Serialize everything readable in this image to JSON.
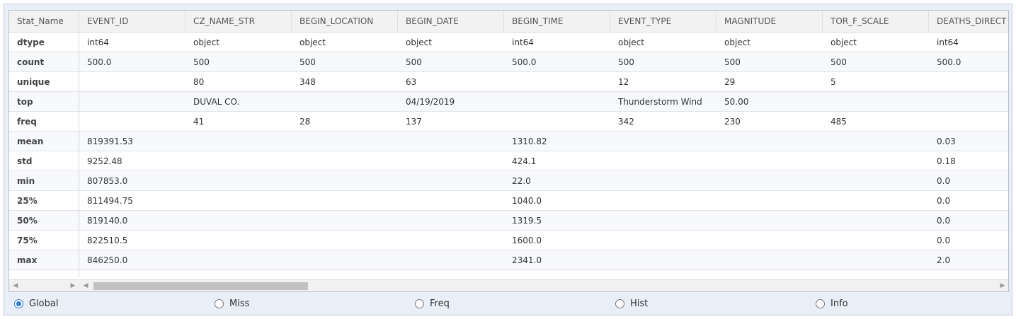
{
  "table": {
    "index_header": "Stat_Name",
    "columns": [
      "EVENT_ID",
      "CZ_NAME_STR",
      "BEGIN_LOCATION",
      "BEGIN_DATE",
      "BEGIN_TIME",
      "EVENT_TYPE",
      "MAGNITUDE",
      "TOR_F_SCALE",
      "DEATHS_DIRECT"
    ],
    "rows": [
      {
        "stat": "dtype",
        "cells": [
          "int64",
          "object",
          "object",
          "object",
          "int64",
          "object",
          "object",
          "object",
          "int64"
        ]
      },
      {
        "stat": "count",
        "cells": [
          "500.0",
          "500",
          "500",
          "500",
          "500.0",
          "500",
          "500",
          "500",
          "500.0"
        ]
      },
      {
        "stat": "unique",
        "cells": [
          "",
          "80",
          "348",
          "63",
          "",
          "12",
          "29",
          "5",
          ""
        ]
      },
      {
        "stat": "top",
        "cells": [
          "",
          "DUVAL CO.",
          "",
          "04/19/2019",
          "",
          "Thunderstorm Wind",
          "50.00",
          "",
          ""
        ]
      },
      {
        "stat": "freq",
        "cells": [
          "",
          "41",
          "28",
          "137",
          "",
          "342",
          "230",
          "485",
          ""
        ]
      },
      {
        "stat": "mean",
        "cells": [
          "819391.53",
          "",
          "",
          "",
          "1310.82",
          "",
          "",
          "",
          "0.03"
        ]
      },
      {
        "stat": "std",
        "cells": [
          "9252.48",
          "",
          "",
          "",
          "424.1",
          "",
          "",
          "",
          "0.18"
        ]
      },
      {
        "stat": "min",
        "cells": [
          "807853.0",
          "",
          "",
          "",
          "22.0",
          "",
          "",
          "",
          "0.0"
        ]
      },
      {
        "stat": "25%",
        "cells": [
          "811494.75",
          "",
          "",
          "",
          "1040.0",
          "",
          "",
          "",
          "0.0"
        ]
      },
      {
        "stat": "50%",
        "cells": [
          "819140.0",
          "",
          "",
          "",
          "1319.5",
          "",
          "",
          "",
          "0.0"
        ]
      },
      {
        "stat": "75%",
        "cells": [
          "822510.5",
          "",
          "",
          "",
          "1600.0",
          "",
          "",
          "",
          "0.0"
        ]
      },
      {
        "stat": "max",
        "cells": [
          "846250.0",
          "",
          "",
          "",
          "2341.0",
          "",
          "",
          "",
          "2.0"
        ]
      }
    ]
  },
  "scrollbar": {
    "left_arrow": "◀",
    "right_arrow": "▶"
  },
  "radio_options": [
    {
      "label": "Global",
      "checked": true
    },
    {
      "label": "Miss",
      "checked": false
    },
    {
      "label": "Freq",
      "checked": false
    },
    {
      "label": "Hist",
      "checked": false
    },
    {
      "label": "Info",
      "checked": false
    }
  ],
  "colors": {
    "accent": "#2d7bd4",
    "header_bg": "#f2f2f2",
    "frame_bg": "#e9eef8"
  }
}
